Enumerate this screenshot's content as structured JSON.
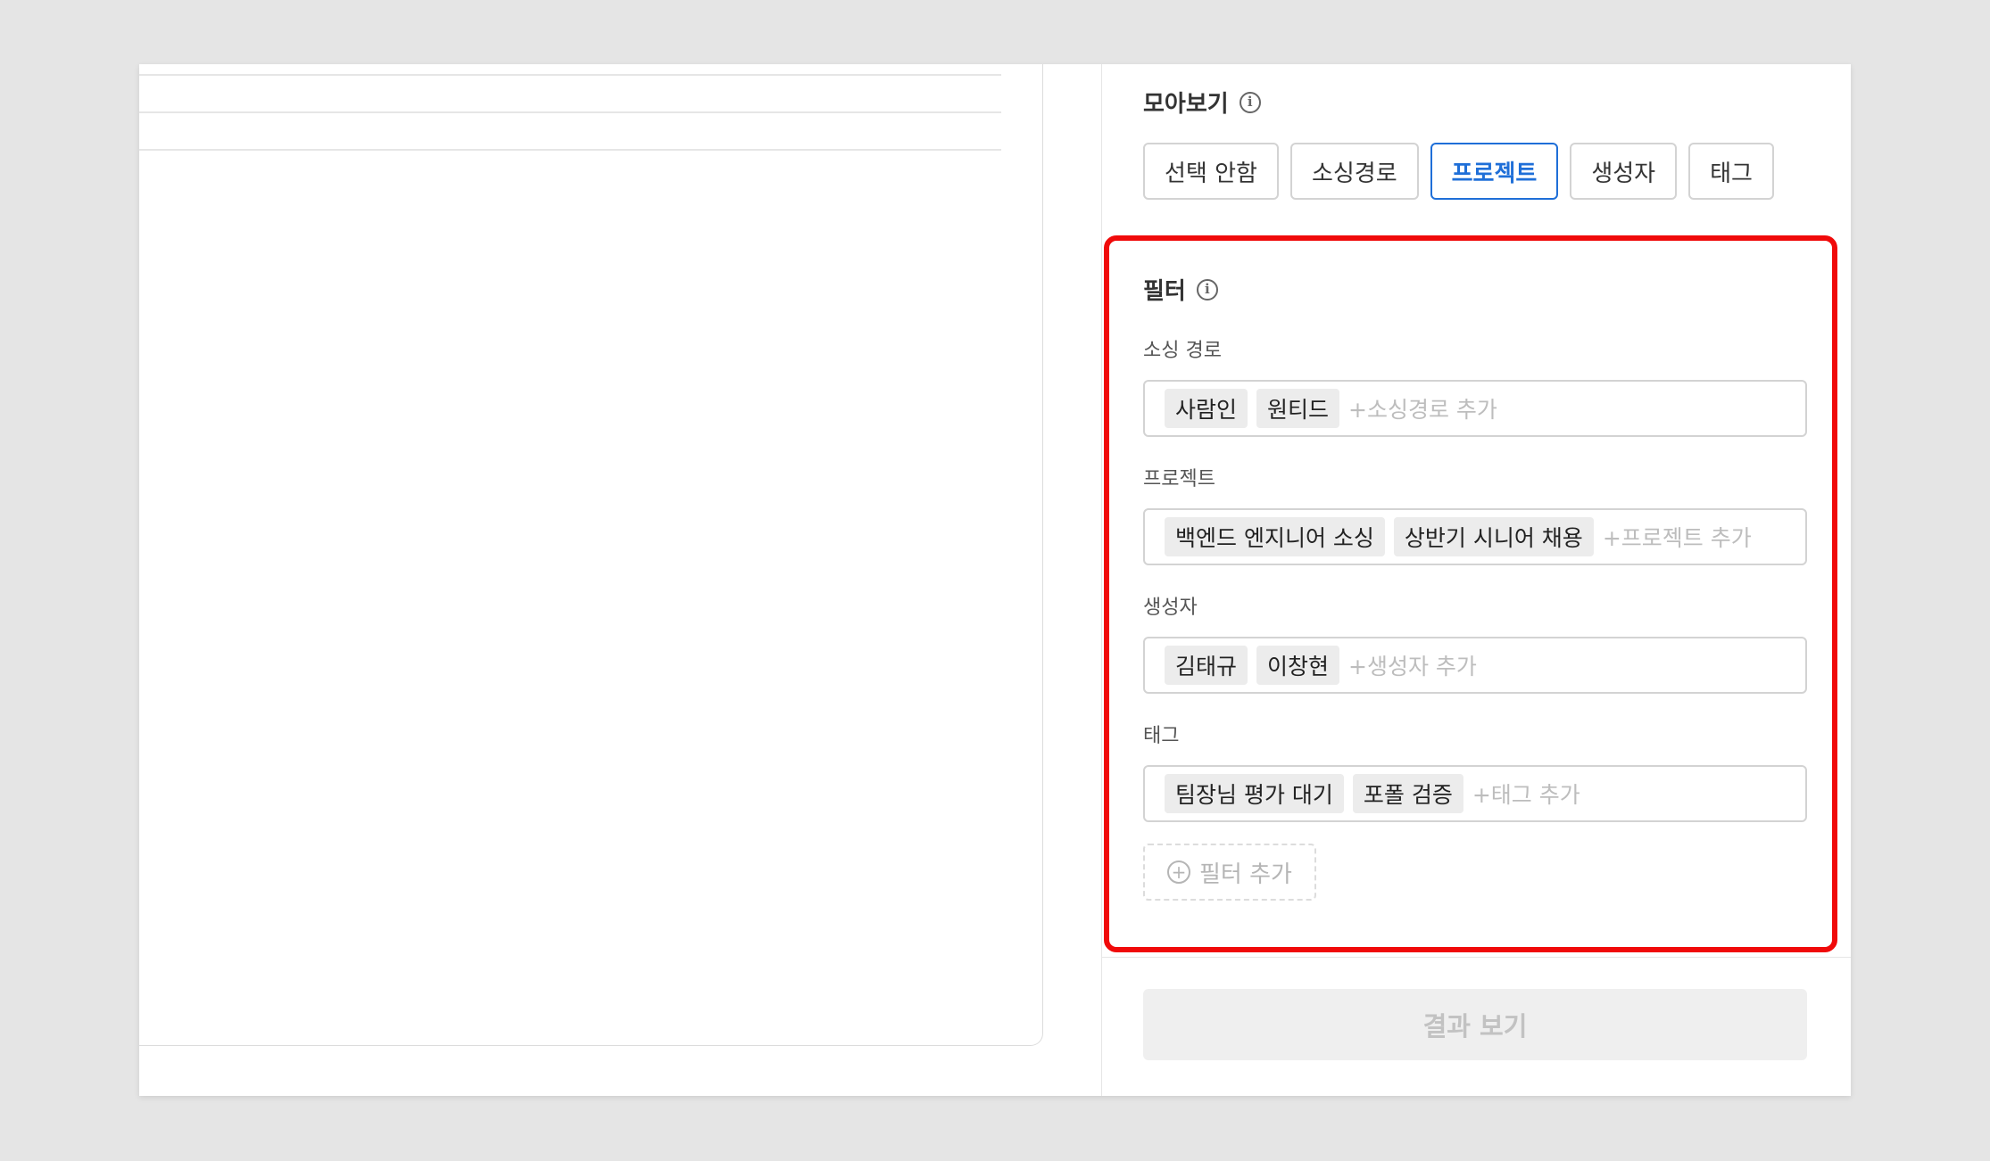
{
  "view_section": {
    "title": "모아보기",
    "buttons": [
      {
        "label": "선택 안함",
        "active": false
      },
      {
        "label": "소싱경로",
        "active": false
      },
      {
        "label": "프로젝트",
        "active": true
      },
      {
        "label": "생성자",
        "active": false
      },
      {
        "label": "태그",
        "active": false
      }
    ]
  },
  "filter_section": {
    "title": "필터",
    "groups": [
      {
        "label": "소싱 경로",
        "chips": [
          "사람인",
          "원티드"
        ],
        "add_hint": "+소싱경로 추가"
      },
      {
        "label": "프로젝트",
        "chips": [
          "백엔드 엔지니어 소싱",
          "상반기 시니어 채용"
        ],
        "add_hint": "+프로젝트 추가"
      },
      {
        "label": "생성자",
        "chips": [
          "김태규",
          "이창현"
        ],
        "add_hint": "+생성자 추가"
      },
      {
        "label": "태그",
        "chips": [
          "팀장님 평가 대기",
          "포폴 검증"
        ],
        "add_hint": "+태그 추가"
      }
    ],
    "add_filter_label": "필터 추가"
  },
  "result_button_label": "결과 보기",
  "colors": {
    "accent": "#1f6fd8",
    "highlight_border": "#f00a0a",
    "chip_bg": "#ececec",
    "placeholder": "#bdbdbd"
  }
}
